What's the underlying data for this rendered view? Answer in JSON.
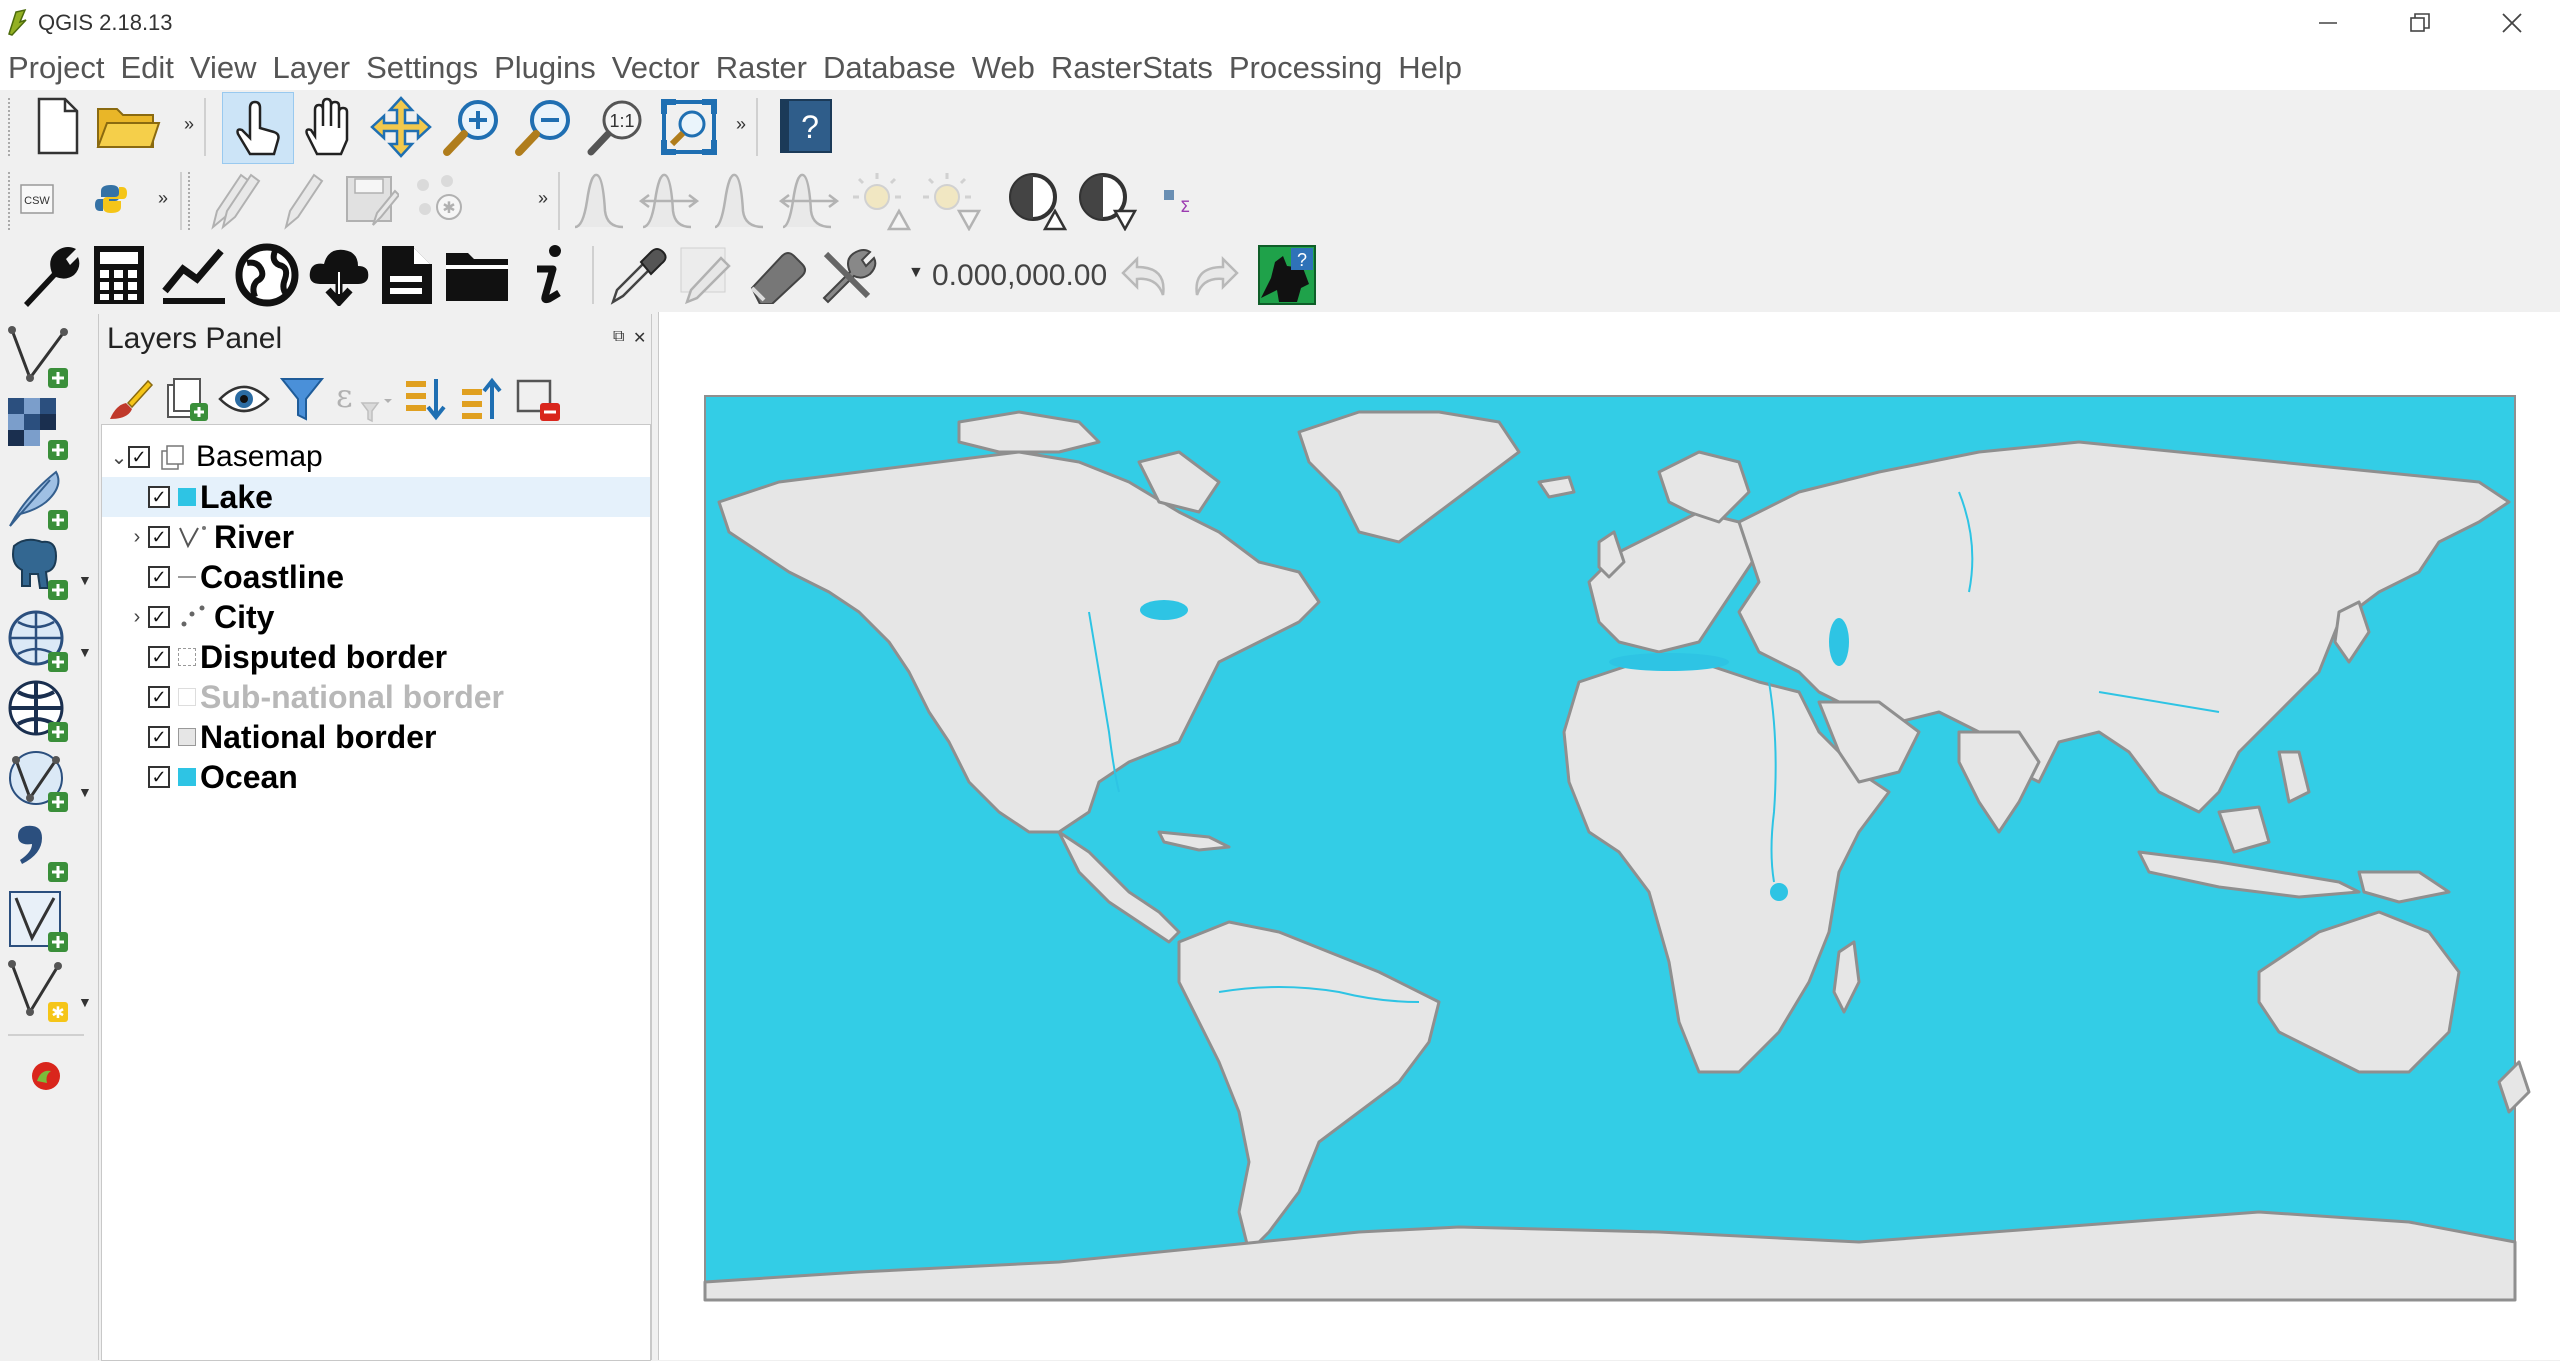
{
  "window": {
    "title": "QGIS 2.18.13"
  },
  "menu": [
    "Project",
    "Edit",
    "View",
    "Layer",
    "Settings",
    "Plugins",
    "Vector",
    "Raster",
    "Database",
    "Web",
    "RasterStats",
    "Processing",
    "Help"
  ],
  "toolbar": {
    "scale_value": "0.000,000.00"
  },
  "layers_panel": {
    "title": "Layers Panel",
    "group": {
      "name": "Basemap",
      "checked": true,
      "expanded": true
    },
    "layers": [
      {
        "name": "Lake",
        "checked": true,
        "expandable": false,
        "symbol": "fill",
        "color": "#2ec4e4",
        "selected": true
      },
      {
        "name": "River",
        "checked": true,
        "expandable": true,
        "symbol": "line-river",
        "color": "#2ec4e4"
      },
      {
        "name": "Coastline",
        "checked": true,
        "expandable": false,
        "symbol": "line",
        "color": "#888888"
      },
      {
        "name": "City",
        "checked": true,
        "expandable": true,
        "symbol": "points",
        "color": "#666666"
      },
      {
        "name": "Disputed border",
        "checked": true,
        "expandable": false,
        "symbol": "dashed",
        "color": "#999999"
      },
      {
        "name": "Sub-national border",
        "checked": true,
        "expandable": false,
        "symbol": "outline-light",
        "color": "#cccccc",
        "dimmed": true
      },
      {
        "name": "National border",
        "checked": true,
        "expandable": false,
        "symbol": "outline",
        "color": "#999999"
      },
      {
        "name": "Ocean",
        "checked": true,
        "expandable": false,
        "symbol": "fill",
        "color": "#2ec4e4"
      }
    ]
  },
  "map": {
    "ocean_color": "#33cde6",
    "land_color": "#e6e6e6",
    "border_color": "#8f8f8f",
    "water_color": "#2ec4e4"
  }
}
